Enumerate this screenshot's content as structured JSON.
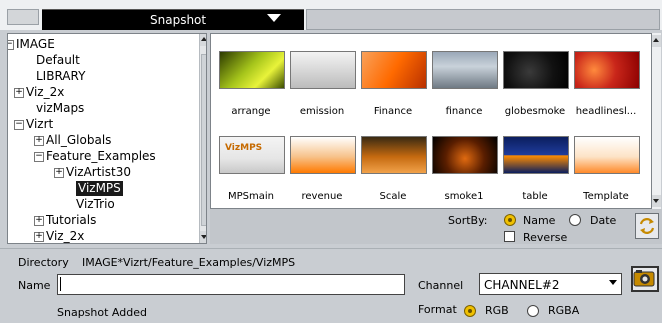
{
  "header": {
    "title": "Snapshot"
  },
  "tree": {
    "nodes": [
      {
        "label": "IMAGE",
        "expander": "−"
      },
      {
        "label": "Default"
      },
      {
        "label": "LIBRARY"
      },
      {
        "label": "Viz_2x",
        "expander": "+"
      },
      {
        "label": "vizMaps"
      },
      {
        "label": "Vizrt",
        "expander": "−"
      },
      {
        "label": "All_Globals",
        "expander": "+"
      },
      {
        "label": "Feature_Examples",
        "expander": "−"
      },
      {
        "label": "VizArtist30",
        "expander": "+"
      },
      {
        "label": "VizMPS",
        "selected": true
      },
      {
        "label": "VizTrio"
      },
      {
        "label": "Tutorials",
        "expander": "+"
      },
      {
        "label": "Viz_2x",
        "expander": "+"
      }
    ]
  },
  "thumbnails": [
    {
      "label": "arrange"
    },
    {
      "label": "emission"
    },
    {
      "label": "Finance"
    },
    {
      "label": "finance"
    },
    {
      "label": "globesmoke"
    },
    {
      "label": "headlinesl..."
    },
    {
      "label": "MPSmain",
      "overlay": "VizMPS"
    },
    {
      "label": "revenue"
    },
    {
      "label": "Scale"
    },
    {
      "label": "smoke1"
    },
    {
      "label": "table"
    },
    {
      "label": "Template"
    }
  ],
  "sort": {
    "label": "SortBy:",
    "options": [
      "Name",
      "Date"
    ],
    "selected": "Name",
    "reverse_label": "Reverse",
    "reverse_checked": false
  },
  "directory": {
    "label": "Directory",
    "path": "IMAGE*Vizrt/Feature_Examples/VizMPS"
  },
  "name_field": {
    "label": "Name",
    "value": ""
  },
  "channel": {
    "label": "Channel",
    "value": "CHANNEL#2"
  },
  "format": {
    "label": "Format",
    "options": [
      "RGB",
      "RGBA"
    ],
    "selected": "RGB"
  },
  "status": "Snapshot Added",
  "icons": {
    "refresh": "refresh-icon",
    "camera": "camera-icon"
  },
  "colors": {
    "accent": "#f0c000",
    "tab_bg": "#000000",
    "selection": "#1a1a1a"
  }
}
